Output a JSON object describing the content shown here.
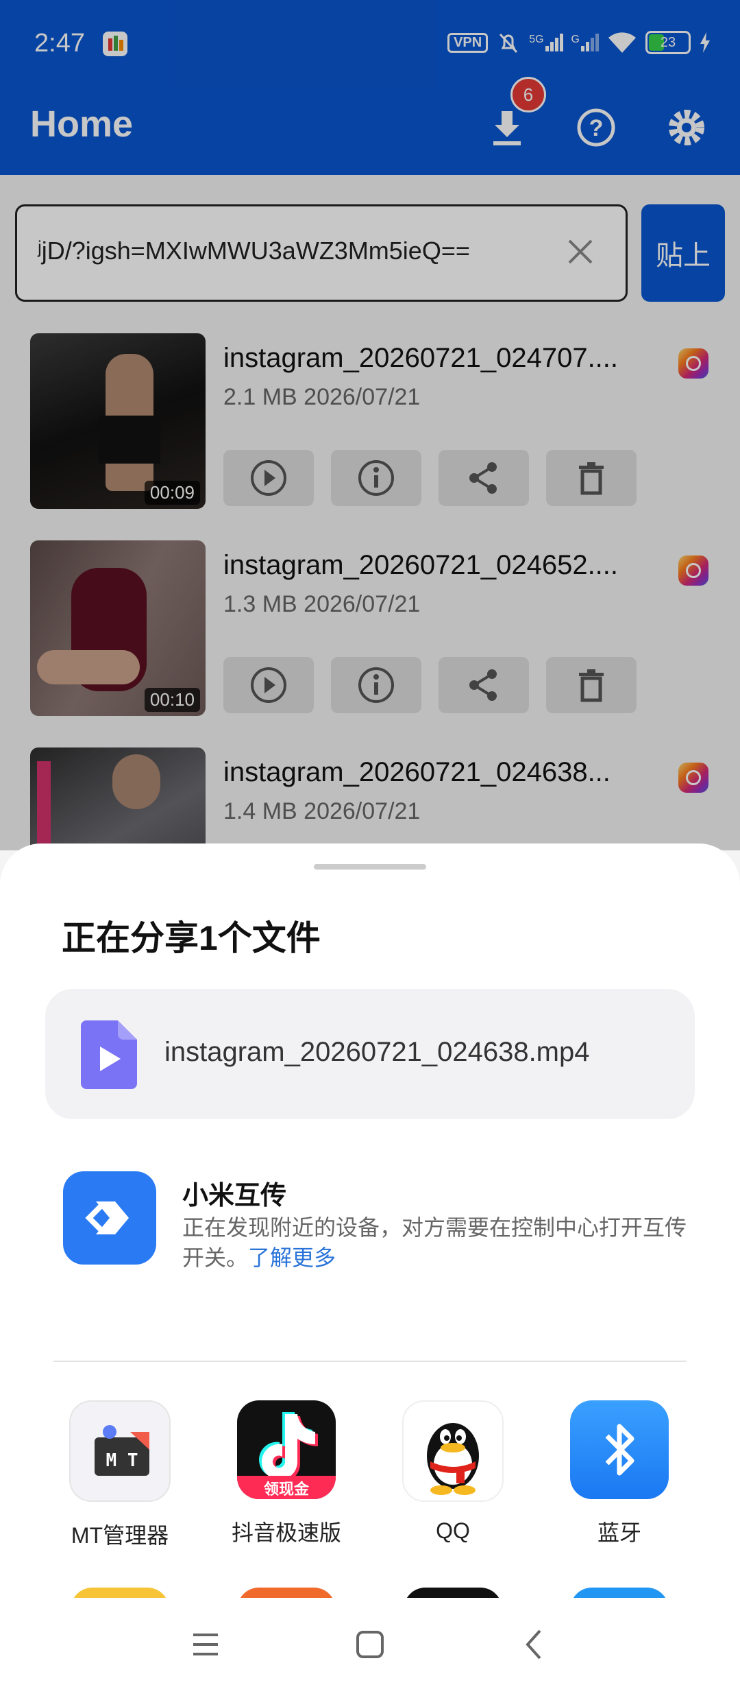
{
  "status": {
    "time": "2:47",
    "vpn": "VPN",
    "net1": "5G",
    "net2": "G",
    "battery": "23"
  },
  "appbar": {
    "title": "Home",
    "download_badge": "6"
  },
  "search": {
    "value": "ʲjD/?igsh=MXIwMWU3aWZ3Mm5ieQ==",
    "paste_label": "贴上"
  },
  "downloads": [
    {
      "name": "instagram_20260721_024707....",
      "size": "2.1 MB",
      "date": "2026/07/21",
      "duration": "00:09"
    },
    {
      "name": "instagram_20260721_024652....",
      "size": "1.3 MB",
      "date": "2026/07/21",
      "duration": "00:10"
    },
    {
      "name": "instagram_20260721_024638...",
      "size": "1.4 MB",
      "date": "2026/07/21",
      "duration": ""
    }
  ],
  "share": {
    "title": "正在分享1个文件",
    "file_name": "instagram_20260721_024638.mp4",
    "mi_title": "小米互传",
    "mi_desc": "正在发现附近的设备，对方需要在控制中心打开互传开关。",
    "mi_link": "了解更多",
    "apps": [
      {
        "label": "MT管理器",
        "icon": "mt-manager-icon"
      },
      {
        "label": "抖音极速版",
        "icon": "douyin-lite-icon",
        "tag": "领现金"
      },
      {
        "label": "QQ",
        "icon": "qq-icon"
      },
      {
        "label": "蓝牙",
        "icon": "bluetooth-icon"
      }
    ]
  },
  "colors": {
    "primary": "#0a56d0",
    "mi_blue": "#2a7bf3",
    "file_purple": "#7b73f5"
  }
}
